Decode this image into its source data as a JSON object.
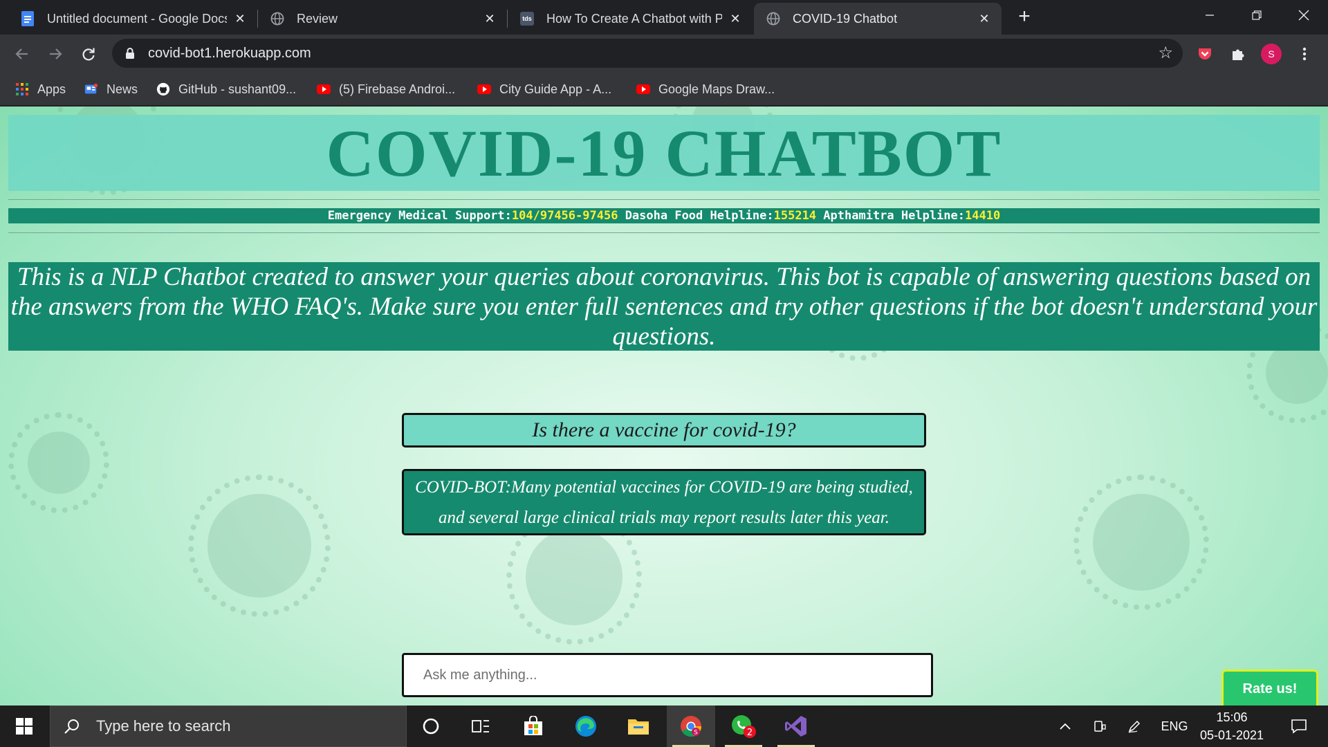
{
  "browser": {
    "tabs": [
      {
        "title": "Untitled document - Google Docs",
        "icon": "google-docs-icon"
      },
      {
        "title": "Review",
        "icon": "globe-icon"
      },
      {
        "title": "How To Create A Chatbot with Python",
        "icon": "tds-icon",
        "icon_text": "tds"
      },
      {
        "title": "COVID-19 Chatbot",
        "icon": "globe-icon",
        "active": true
      }
    ],
    "url": "covid-bot1.herokuapp.com",
    "profile_initial": "S",
    "bookmarks": [
      {
        "label": "Apps",
        "icon": "apps-grid-icon"
      },
      {
        "label": "News",
        "icon": "news-icon"
      },
      {
        "label": "GitHub - sushant09...",
        "icon": "github-icon"
      },
      {
        "label": "(5) Firebase Androi...",
        "icon": "youtube-icon"
      },
      {
        "label": "City Guide App - A...",
        "icon": "youtube-icon"
      },
      {
        "label": "Google Maps Draw...",
        "icon": "youtube-icon"
      }
    ]
  },
  "page": {
    "title": "COVID-19 CHATBOT",
    "helplines": [
      {
        "label": "Emergency Medical Support:",
        "number": "104/97456-97456"
      },
      {
        "label": "Dasoha Food Helpline:",
        "number": "155214"
      },
      {
        "label": "Apthamitra Helpline:",
        "number": "14410"
      }
    ],
    "intro": "This is a NLP Chatbot created to answer your queries about coronavirus. This bot is capable of answering questions based on the answers from the WHO FAQ's. Make sure you enter full sentences and try other questions if the bot doesn't understand your questions.",
    "user_message": "Is there a vaccine for covid-19?",
    "bot_message": "COVID-BOT:Many potential vaccines for COVID-19 are being studied, and several large clinical trials may report results later this year.",
    "input_placeholder": "Ask me anything...",
    "rate_label": "Rate us!"
  },
  "taskbar": {
    "search_placeholder": "Type here to search",
    "whatsapp_badge": "2",
    "chrome_profile_badge": "S",
    "language": "ENG",
    "time": "15:06",
    "date": "05-01-2021"
  },
  "colors": {
    "accent": "#168a6e",
    "header_bg": "#73d8c4",
    "helpline_number": "#ffee33"
  }
}
